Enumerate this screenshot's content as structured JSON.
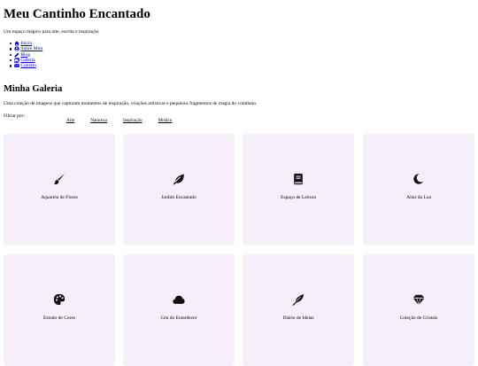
{
  "header": {
    "title": "Meu Cantinho Encantado",
    "tagline": "Um espaço mágico para arte, escrita e inspiração"
  },
  "nav": {
    "items": [
      {
        "label": "Início",
        "icon": "home-icon"
      },
      {
        "label": "Sobre Mim",
        "icon": "user-icon"
      },
      {
        "label": "Blog",
        "icon": "pencil-icon"
      },
      {
        "label": "Galeria",
        "icon": "images-icon"
      },
      {
        "label": "Contato",
        "icon": "envelope-icon"
      }
    ]
  },
  "gallery": {
    "title": "Minha Galeria",
    "description": "Uma coleção de imagens que capturam momentos de inspiração, criações artísticas e pequenos fragmentos de magia do cotidiano.",
    "filter_label": "Filtrar por:",
    "filters": [
      "Arte",
      "Natureza",
      "Inspiração",
      "Místico"
    ],
    "items": [
      {
        "label": "Aquarela de Flores",
        "icon": "paintbrush-icon"
      },
      {
        "label": "Jardim Encantado",
        "icon": "leaf-icon"
      },
      {
        "label": "Espaço de Leitura",
        "icon": "book-icon"
      },
      {
        "label": "Altar da Lua",
        "icon": "moon-icon"
      },
      {
        "label": "Estudo de Cores",
        "icon": "palette-icon"
      },
      {
        "label": "Céu do Entardecer",
        "icon": "cloud-icon"
      },
      {
        "label": "Diário de Ideias",
        "icon": "feather-icon"
      },
      {
        "label": "Coleção de Cristais",
        "icon": "gem-icon"
      }
    ]
  },
  "colors": {
    "card_background": "#f6eef8",
    "link": "#0000ee",
    "text": "#000000"
  }
}
